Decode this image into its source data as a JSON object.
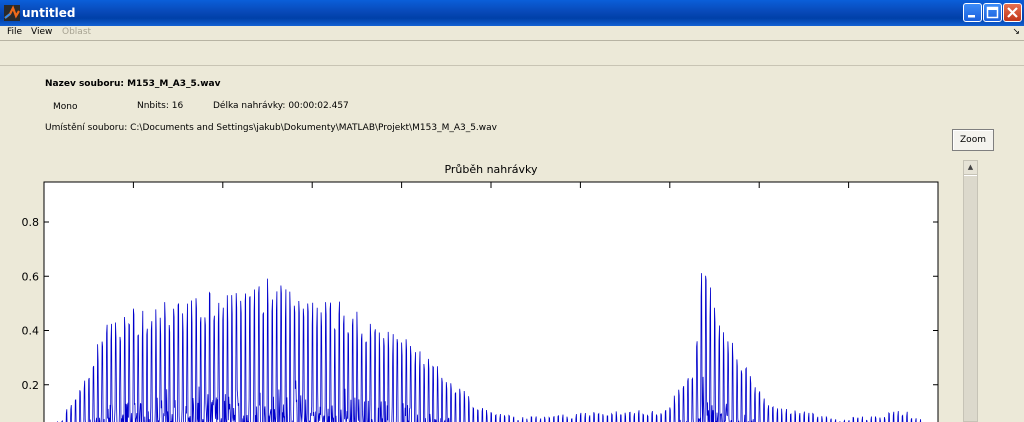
{
  "window": {
    "title": "untitled",
    "icon": "matlab-icon",
    "controls": [
      "minimize-icon",
      "maximize-icon",
      "close-icon"
    ]
  },
  "menu": {
    "items": [
      {
        "label": "File",
        "enabled": true
      },
      {
        "label": "View",
        "enabled": true
      },
      {
        "label": "Oblast",
        "enabled": false
      }
    ],
    "dock_arrow": "↘"
  },
  "info": {
    "filename": "Nazev souboru: M153_M_A3_5.wav",
    "channels": "Mono",
    "nbits": "Nnbits: 16",
    "duration": "Délka nahrávky: 00:00:02.457",
    "location": "Umístění souboru: C:\\Documents and Settings\\jakub\\Dokumenty\\MATLAB\\Projekt\\M153_M_A3_5.wav"
  },
  "zoom_button": {
    "label": "Zoom"
  },
  "scrollbar": {
    "up_arrow": "▲"
  },
  "colors": {
    "series": "#0000cc",
    "background": "#ece9d8"
  },
  "chart_data": {
    "type": "line",
    "title": "Průběh nahrávky",
    "xlabel": "",
    "ylabel": "",
    "ylim": [
      0.0,
      0.95
    ],
    "xlim": [
      0,
      2.457
    ],
    "yticks": [
      0.2,
      0.4,
      0.6,
      0.8
    ],
    "ytick_labels": [
      "0.2",
      "0.4",
      "0.6",
      "0.8"
    ],
    "grid": false,
    "series": [
      {
        "name": "",
        "color": "#0000cc",
        "envelope": [
          {
            "x": 0.0,
            "y": 0.05
          },
          {
            "x": 0.05,
            "y": 0.08
          },
          {
            "x": 0.1,
            "y": 0.2
          },
          {
            "x": 0.15,
            "y": 0.38
          },
          {
            "x": 0.2,
            "y": 0.47
          },
          {
            "x": 0.3,
            "y": 0.5
          },
          {
            "x": 0.4,
            "y": 0.53
          },
          {
            "x": 0.5,
            "y": 0.55
          },
          {
            "x": 0.6,
            "y": 0.61
          },
          {
            "x": 0.7,
            "y": 0.57
          },
          {
            "x": 0.8,
            "y": 0.52
          },
          {
            "x": 0.9,
            "y": 0.45
          },
          {
            "x": 1.0,
            "y": 0.38
          },
          {
            "x": 1.1,
            "y": 0.25
          },
          {
            "x": 1.2,
            "y": 0.12
          },
          {
            "x": 1.3,
            "y": 0.08
          },
          {
            "x": 1.4,
            "y": 0.09
          },
          {
            "x": 1.5,
            "y": 0.1
          },
          {
            "x": 1.6,
            "y": 0.11
          },
          {
            "x": 1.7,
            "y": 0.1
          },
          {
            "x": 1.78,
            "y": 0.25
          },
          {
            "x": 1.81,
            "y": 0.67
          },
          {
            "x": 1.86,
            "y": 0.42
          },
          {
            "x": 1.9,
            "y": 0.34
          },
          {
            "x": 1.95,
            "y": 0.22
          },
          {
            "x": 2.0,
            "y": 0.12
          },
          {
            "x": 2.1,
            "y": 0.1
          },
          {
            "x": 2.2,
            "y": 0.08
          },
          {
            "x": 2.3,
            "y": 0.09
          },
          {
            "x": 2.36,
            "y": 0.11
          },
          {
            "x": 2.4,
            "y": 0.08
          },
          {
            "x": 2.457,
            "y": 0.05
          }
        ]
      }
    ]
  }
}
